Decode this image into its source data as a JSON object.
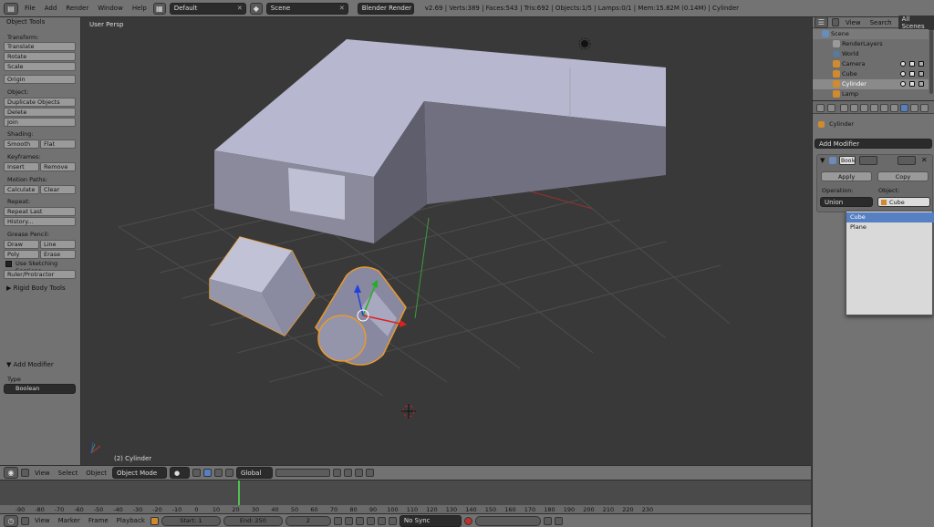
{
  "top_bar": {
    "menus": [
      "File",
      "Add",
      "Render",
      "Window",
      "Help"
    ],
    "layout": "Default",
    "scene": "Scene",
    "engine": "Blender Render",
    "stats": "v2.69 | Verts:389 | Faces:543 | Tris:692 | Objects:1/5 | Lamps:0/1 | Mem:15.82M (0.14M) | Cylinder"
  },
  "tools": {
    "title": "Object Tools",
    "transform_label": "Transform:",
    "translate": "Translate",
    "rotate": "Rotate",
    "scale": "Scale",
    "origin": "Origin",
    "object_label": "Object:",
    "duplicate": "Duplicate Objects",
    "delete": "Delete",
    "join": "Join",
    "shading_label": "Shading:",
    "smooth": "Smooth",
    "flat": "Flat",
    "keyframes_label": "Keyframes:",
    "insert": "Insert",
    "remove": "Remove",
    "motion_label": "Motion Paths:",
    "calculate": "Calculate",
    "clear": "Clear",
    "repeat_label": "Repeat:",
    "repeat_last": "Repeat Last",
    "history": "History...",
    "gp_label": "Grease Pencil:",
    "draw": "Draw",
    "line": "Line",
    "poly": "Poly",
    "erase": "Erase",
    "sketch": "Use Sketching Sessions",
    "ruler": "Ruler/Protractor",
    "rigid": "Rigid Body Tools",
    "add_modifier": "Add Modifier",
    "type_label": "Type",
    "type_value": "Boolean"
  },
  "viewport": {
    "view_label": "User Persp",
    "object_label": "(2) Cylinder"
  },
  "viewport_header": {
    "view": "View",
    "select": "Select",
    "object": "Object",
    "mode": "Object Mode",
    "orientation": "Global"
  },
  "timeline": {
    "ticks": [
      "-90",
      "-80",
      "-70",
      "-60",
      "-50",
      "-40",
      "-30",
      "-20",
      "-10",
      "0",
      "10",
      "20",
      "30",
      "40",
      "50",
      "60",
      "70",
      "80",
      "90",
      "100",
      "110",
      "120",
      "130",
      "140",
      "150",
      "160",
      "170",
      "180",
      "190",
      "200",
      "210",
      "220",
      "230"
    ]
  },
  "bottom_bar": {
    "view": "View",
    "marker": "Marker",
    "frame": "Frame",
    "playback": "Playback",
    "start": "Start: 1",
    "end": "End: 250",
    "current": "2",
    "sync": "No Sync"
  },
  "outliner": {
    "view": "View",
    "search": "Search",
    "all_scenes": "All Scenes",
    "items": [
      {
        "label": "Scene",
        "icon_color": "#6a8cb8"
      },
      {
        "label": "RenderLayers",
        "icon_color": "#9a9a9a"
      },
      {
        "label": "World",
        "icon_color": "#5a7a9a"
      },
      {
        "label": "Camera",
        "icon_color": "#d08a30"
      },
      {
        "label": "Cube",
        "icon_color": "#d08a30"
      },
      {
        "label": "Cylinder",
        "icon_color": "#d08a30"
      },
      {
        "label": "Lamp",
        "icon_color": "#d08a30"
      }
    ]
  },
  "properties": {
    "object_name": "Cylinder",
    "add_modifier": "Add Modifier",
    "modifier_name": "Boolean",
    "apply": "Apply",
    "copy": "Copy",
    "operation_label": "Operation:",
    "operation_value": "Union",
    "object_label": "Object:",
    "object_value": "Cube",
    "dropdown": [
      "Cube",
      "Plane"
    ]
  },
  "colors": {
    "selection": "#e89a2c",
    "header_bg": "#727272",
    "viewport_bg": "#393939",
    "highlight": "#5680c2"
  }
}
